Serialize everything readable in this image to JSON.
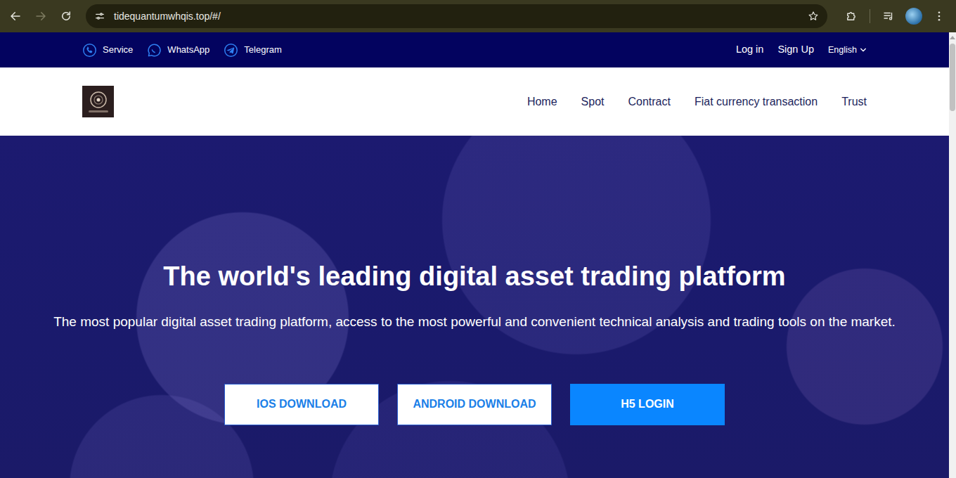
{
  "browser": {
    "url": "tidequantumwhqis.top/#/",
    "back_enabled": true,
    "forward_enabled": false
  },
  "topbar": {
    "contacts": [
      {
        "label": "Service",
        "kind": "service"
      },
      {
        "label": "WhatsApp",
        "kind": "whatsapp"
      },
      {
        "label": "Telegram",
        "kind": "telegram"
      }
    ],
    "links": [
      {
        "label": "Log in"
      },
      {
        "label": "Sign Up"
      }
    ],
    "language": "English"
  },
  "navbar": {
    "items": [
      {
        "label": "Home"
      },
      {
        "label": "Spot"
      },
      {
        "label": "Contract"
      },
      {
        "label": "Fiat currency transaction"
      },
      {
        "label": "Trust"
      }
    ]
  },
  "hero": {
    "title": "The world's leading digital asset trading platform",
    "subtitle": "The most popular digital asset trading platform, access to the most powerful and convenient technical analysis and trading tools on the market.",
    "buttons": [
      {
        "label": "IOS DOWNLOAD",
        "kind": "outline"
      },
      {
        "label": "ANDROID DOWNLOAD",
        "kind": "outline"
      },
      {
        "label": "H5 LOGIN",
        "kind": "primary"
      }
    ]
  }
}
